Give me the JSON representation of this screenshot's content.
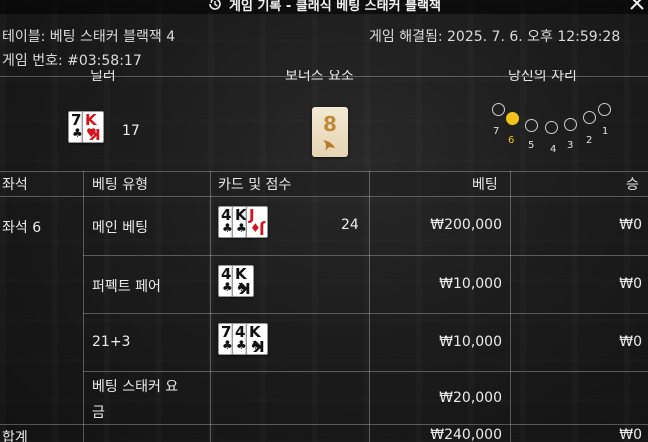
{
  "title": "게임 기록 - 클래식 베팅 스태커 블랙잭",
  "table_label": "테이블: 베팅 스태커 블랙잭 4",
  "resolved": "게임 해결됨: 2025. 7. 6. 오후 12:59:28",
  "round": "게임 번호: #03:58:17",
  "headers": {
    "dealer": "딜러",
    "bonus": "보너스 요소",
    "your_seat": "당신의 자리"
  },
  "dealer": {
    "cards": [
      {
        "rank": "7",
        "suit": "♣",
        "color": "black"
      },
      {
        "rank": "K",
        "suit": "♥",
        "color": "red"
      }
    ],
    "score": "17"
  },
  "bonus": {
    "value": "8"
  },
  "seats": [
    {
      "label": "7",
      "active": false
    },
    {
      "label": "6",
      "active": true
    },
    {
      "label": "5",
      "active": false
    },
    {
      "label": "4",
      "active": false
    },
    {
      "label": "3",
      "active": false
    },
    {
      "label": "2",
      "active": false
    },
    {
      "label": "1",
      "active": false
    }
  ],
  "columns": [
    "좌석",
    "베팅 유형",
    "카드 및 점수",
    "베팅",
    "승"
  ],
  "seat_name": "좌석 6",
  "rows": [
    {
      "type": "메인 베팅",
      "cards": [
        {
          "rank": "4",
          "suit": "♣",
          "color": "black"
        },
        {
          "rank": "K",
          "suit": "♣",
          "color": "black"
        },
        {
          "rank": "J",
          "suit": "♦",
          "color": "red"
        }
      ],
      "score": "24",
      "bet": "₩200,000",
      "win": "₩0"
    },
    {
      "type": "퍼펙트 페어",
      "cards": [
        {
          "rank": "4",
          "suit": "♣",
          "color": "black"
        },
        {
          "rank": "K",
          "suit": "♠",
          "color": "black"
        }
      ],
      "score": "",
      "bet": "₩10,000",
      "win": "₩0"
    },
    {
      "type": "21+3",
      "cards": [
        {
          "rank": "7",
          "suit": "♣",
          "color": "black"
        },
        {
          "rank": "4",
          "suit": "♣",
          "color": "black"
        },
        {
          "rank": "K",
          "suit": "♠",
          "color": "black"
        }
      ],
      "score": "",
      "bet": "₩10,000",
      "win": "₩0"
    },
    {
      "type_line1": "베팅 스태커 요",
      "type_line2": "금",
      "bet": "₩20,000"
    }
  ],
  "total": {
    "label": "합계",
    "bet": "₩240,000",
    "win": "₩0"
  },
  "colors": {
    "accent": "#f2c21b",
    "red_suit": "#d4141c"
  }
}
